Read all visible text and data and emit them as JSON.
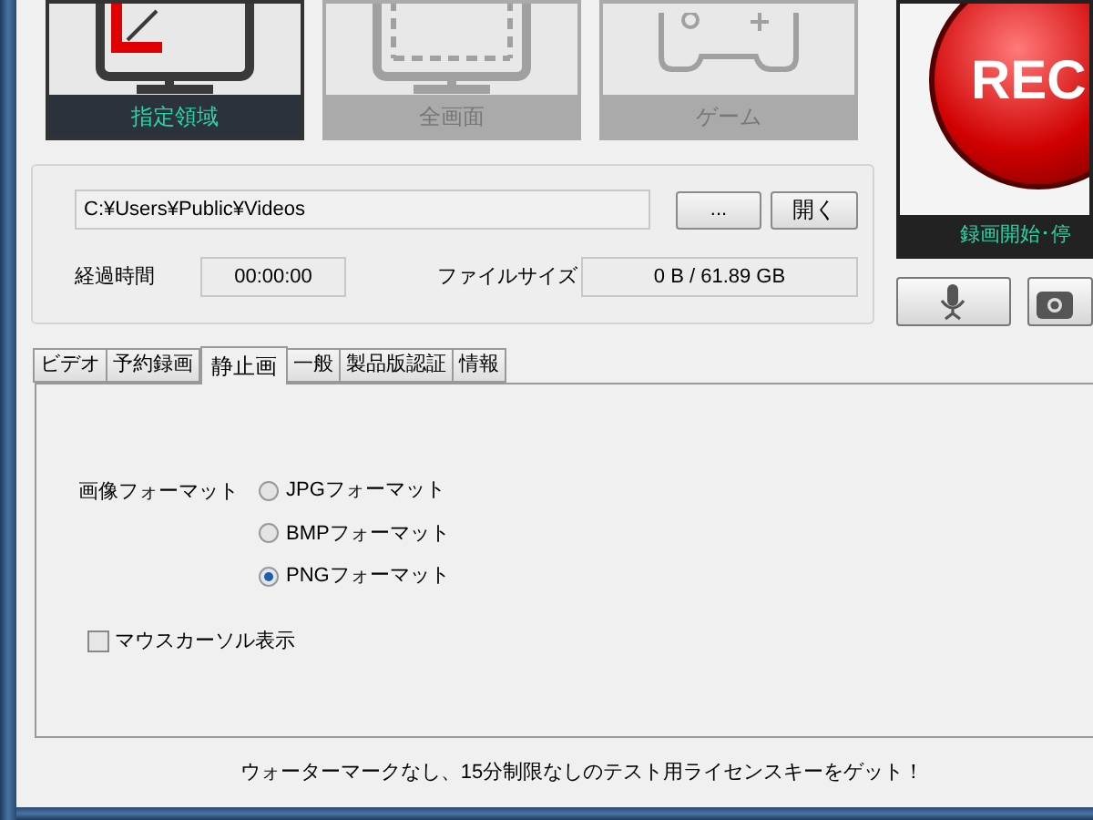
{
  "modes": [
    {
      "kind": "region",
      "label": "指定領域",
      "selected": true
    },
    {
      "kind": "fullscreen",
      "label": "全画面",
      "selected": false
    },
    {
      "kind": "game",
      "label": "ゲーム",
      "selected": false
    }
  ],
  "rec": {
    "label": "REC",
    "caption": "録画開始･停"
  },
  "output": {
    "path": "C:¥Users¥Public¥Videos",
    "browse": "...",
    "open": "開く",
    "elapsed_label": "経過時間",
    "elapsed": "00:00:00",
    "size_label": "ファイルサイズ",
    "size": "0 B / 61.89 GB"
  },
  "tabs": [
    {
      "label": "ビデオ",
      "selected": false
    },
    {
      "label": "予約録画",
      "selected": false
    },
    {
      "label": "静止画",
      "selected": true
    },
    {
      "label": "一般",
      "selected": false
    },
    {
      "label": "製品版認証",
      "selected": false
    },
    {
      "label": "情報",
      "selected": false
    }
  ],
  "image_format": {
    "label": "画像フォーマット",
    "options": [
      {
        "label": "JPGフォーマット",
        "selected": false
      },
      {
        "label": "BMPフォーマット",
        "selected": false
      },
      {
        "label": "PNGフォーマット",
        "selected": true
      }
    ]
  },
  "mouse_cursor": {
    "label": "マウスカーソル表示",
    "checked": false
  },
  "footer": "ウォーターマークなし、15分制限なしのテスト用ライセンスキーをゲット！"
}
